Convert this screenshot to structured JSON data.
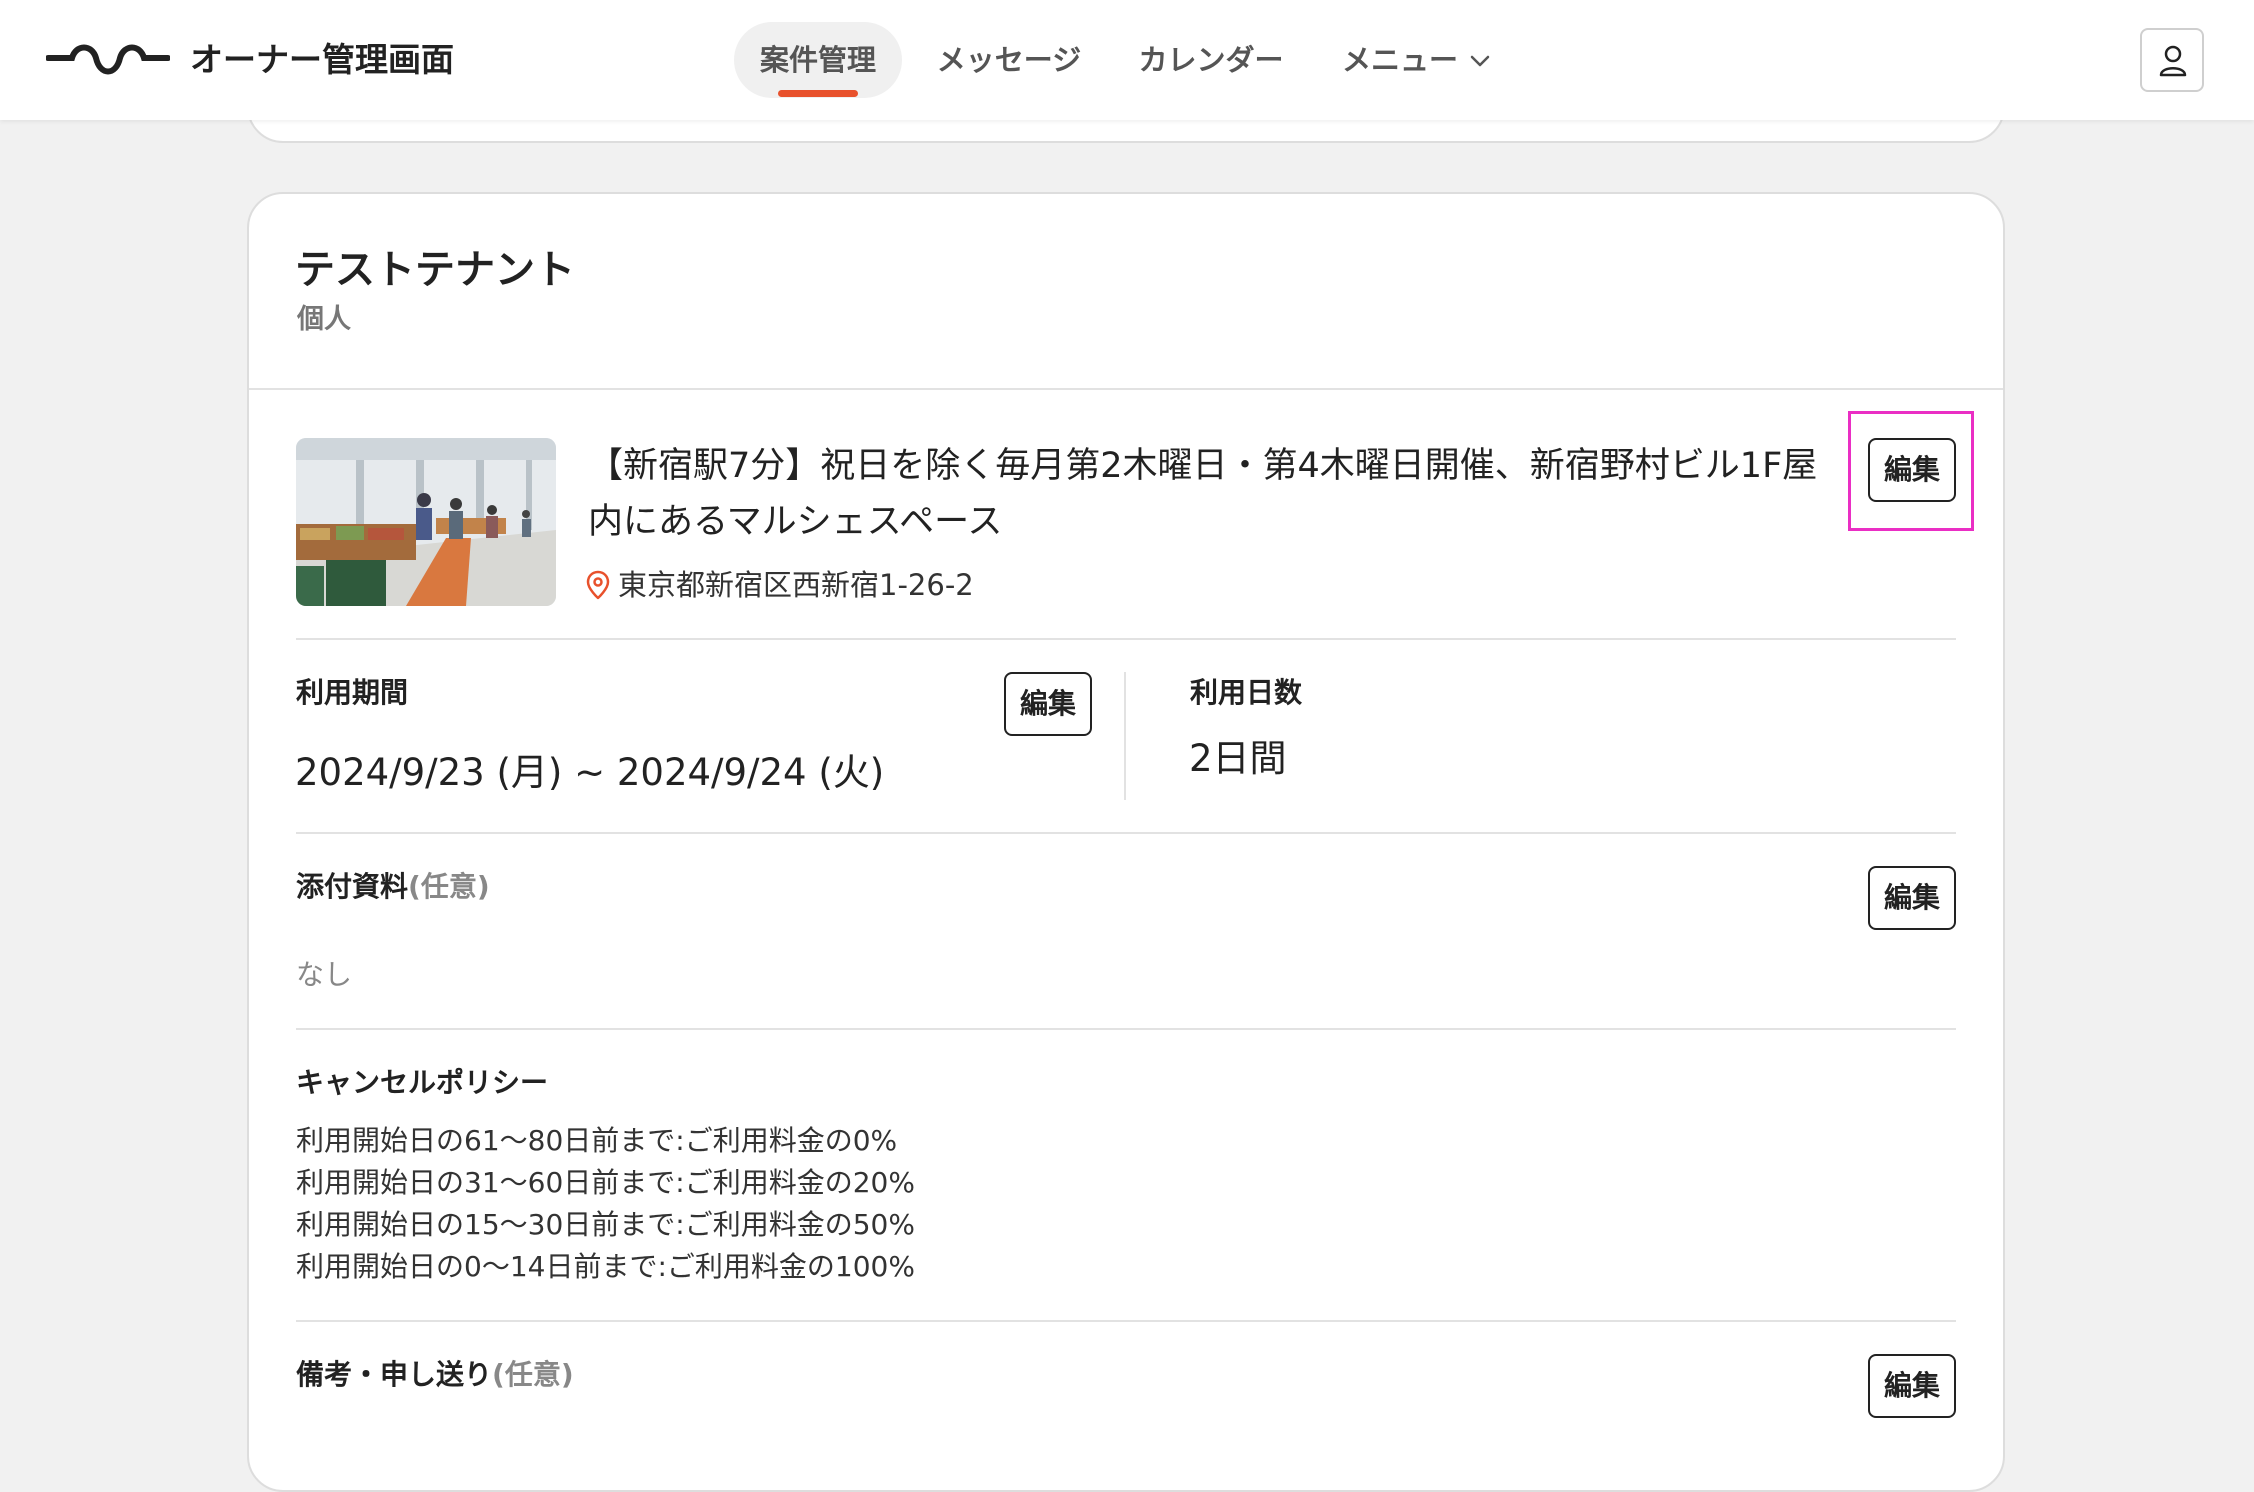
{
  "header": {
    "app_title": "オーナー管理画面",
    "nav": [
      {
        "label": "案件管理"
      },
      {
        "label": "メッセージ"
      },
      {
        "label": "カレンダー"
      },
      {
        "label": "メニュー"
      }
    ],
    "accent_color": "#e8512c"
  },
  "tenant": {
    "name": "テストテナント",
    "type": "個人"
  },
  "listing": {
    "title": "【新宿駅7分】祝日を除く毎月第2木曜日・第4木曜日開催、新宿野村ビル1F屋内にあるマルシェスペース",
    "address": "東京都新宿区西新宿1-26-2",
    "edit_label": "編集"
  },
  "usage_period": {
    "label": "利用期間",
    "value": "2024/9/23 (月) ~ 2024/9/24 (火)",
    "edit_label": "編集"
  },
  "usage_days": {
    "label": "利用日数",
    "value": "2日間"
  },
  "attachments": {
    "label": "添付資料",
    "optional": "(任意)",
    "value": "なし",
    "edit_label": "編集"
  },
  "cancel_policy": {
    "label": "キャンセルポリシー",
    "lines": [
      "利用開始日の61〜80日前まで:ご利用料金の0%",
      "利用開始日の31〜60日前まで:ご利用料金の20%",
      "利用開始日の15〜30日前まで:ご利用料金の50%",
      "利用開始日の0〜14日前まで:ご利用料金の100%"
    ]
  },
  "remarks": {
    "label": "備考・申し送り",
    "optional": "(任意)",
    "edit_label": "編集"
  }
}
